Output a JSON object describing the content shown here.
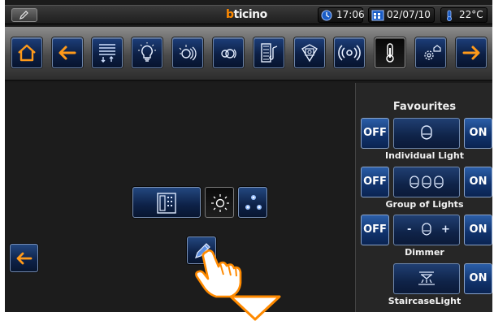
{
  "status_bar": {
    "edit_icon": "pencil-icon",
    "brand_b": "b",
    "brand_rest": "ticino",
    "time": "17:06",
    "date": "02/07/10",
    "temperature": "22°C"
  },
  "toolbar": {
    "items": [
      {
        "id": "home",
        "icon": "home-icon"
      },
      {
        "id": "back",
        "icon": "back-arrow-icon"
      },
      {
        "id": "shutters",
        "icon": "shutter-icon"
      },
      {
        "id": "lighting",
        "icon": "light-bulb-icon"
      },
      {
        "id": "scenarios",
        "icon": "scenario-icon"
      },
      {
        "id": "scenarios-2",
        "icon": "scenario-alt-icon"
      },
      {
        "id": "multimedia",
        "icon": "multimedia-icon"
      },
      {
        "id": "video-door-entry",
        "icon": "video-door-icon"
      },
      {
        "id": "sound-system",
        "icon": "sound-icon"
      },
      {
        "id": "temperature",
        "icon": "thermometer-icon",
        "active": true
      },
      {
        "id": "settings",
        "icon": "gear-house-icon"
      },
      {
        "id": "forward",
        "icon": "forward-arrow-icon"
      }
    ]
  },
  "main": {
    "widgets": [
      {
        "id": "intercom",
        "icon": "intercom-icon"
      },
      {
        "id": "brightness",
        "icon": "sun-icon"
      },
      {
        "id": "scene",
        "icon": "scene-dots-icon"
      },
      {
        "id": "edit",
        "icon": "pencil-icon"
      }
    ]
  },
  "favourites": {
    "title": "Favourites",
    "items": [
      {
        "label": "Individual Light",
        "off": "OFF",
        "on": "ON",
        "icon": "single-bulb-icon"
      },
      {
        "label": "Group of Lights",
        "off": "OFF",
        "on": "ON",
        "icon": "bulb-group-icon"
      },
      {
        "label": "Dimmer",
        "off": "OFF",
        "on": "ON",
        "icon": "dimmer-icon",
        "minus": "-",
        "plus": "+"
      },
      {
        "label": "StaircaseLight",
        "on": "ON",
        "icon": "staircase-light-icon"
      }
    ]
  },
  "colors": {
    "accent_orange": "#ff8a00",
    "button_blue": "#10326b",
    "screen_bg": "#1c1c1c"
  }
}
